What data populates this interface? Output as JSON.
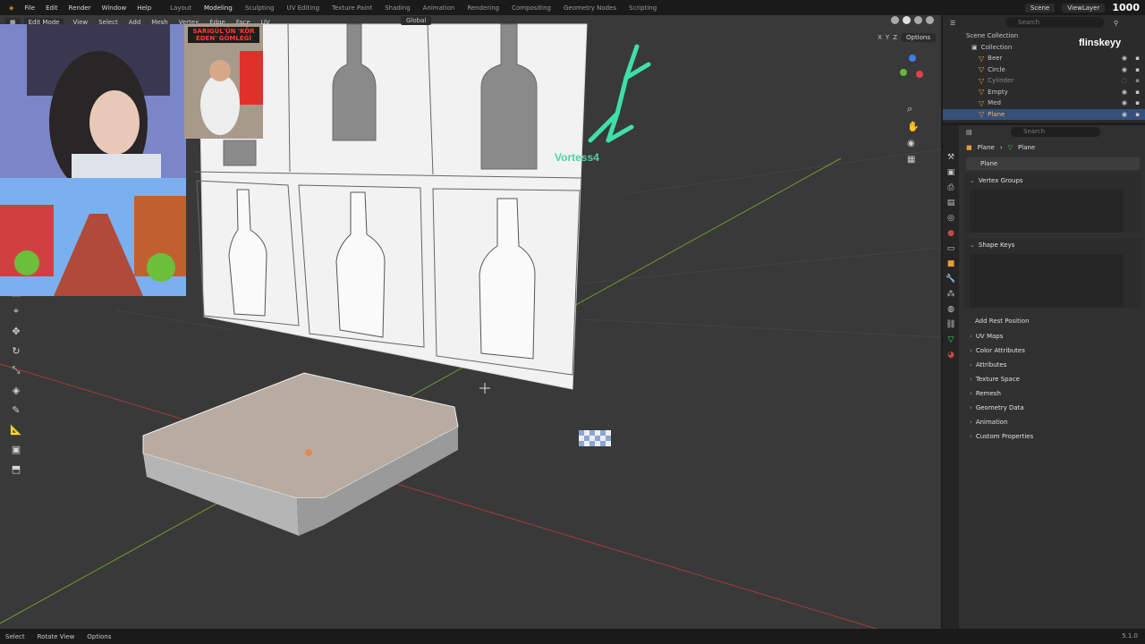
{
  "topbar": {
    "menus": [
      "File",
      "Edit",
      "Render",
      "Window",
      "Help"
    ],
    "workspaces": [
      "Layout",
      "Modeling",
      "Sculpting",
      "UV Editing",
      "Texture Paint",
      "Shading",
      "Animation",
      "Rendering",
      "Compositing",
      "Geometry Nodes",
      "Scripting"
    ],
    "active_workspace": "Modeling",
    "scene": "Scene",
    "view_layer": "ViewLayer",
    "overlay_count": "1000"
  },
  "viewport": {
    "mode": "Edit Mode",
    "header_items": [
      "View",
      "Select",
      "Add",
      "Mesh",
      "Vertex",
      "Edge",
      "Face",
      "UV"
    ],
    "orientation": "Global",
    "axes": [
      "X",
      "Y",
      "Z"
    ],
    "options": "Options",
    "viewer_tag": "Vortess4"
  },
  "overlay": {
    "news_headline": "SARIGÜL'ÜN 'KÖR EDEN' GÖMLEĞİ",
    "brand": "flinskeyy"
  },
  "outliner": {
    "title": "Scene Collection",
    "search_placeholder": "Search",
    "collection": "Collection",
    "items": [
      {
        "name": "Beer"
      },
      {
        "name": "Circle"
      },
      {
        "name": "Cylinder"
      },
      {
        "name": "Empty"
      },
      {
        "name": "Med"
      },
      {
        "name": "Plane",
        "selected": true
      }
    ]
  },
  "properties": {
    "search_placeholder": "Search",
    "breadcrumb": [
      "Plane",
      "Plane"
    ],
    "data_name": "Plane",
    "panels_open": [
      "Vertex Groups",
      "Shape Keys"
    ],
    "add_rest_position": "Add Rest Position",
    "panels_closed": [
      "UV Maps",
      "Color Attributes",
      "Attributes",
      "Texture Space",
      "Remesh",
      "Geometry Data",
      "Animation",
      "Custom Properties"
    ]
  },
  "statusbar": {
    "items": [
      "Select",
      "Rotate View",
      "Options"
    ],
    "version": "5.1.0"
  },
  "colors": {
    "viewport_bg": "#393939",
    "panel_bg": "#303030",
    "selection": "#35507a",
    "accent": "#e89a3c",
    "mesh_green": "#3ec46a"
  }
}
